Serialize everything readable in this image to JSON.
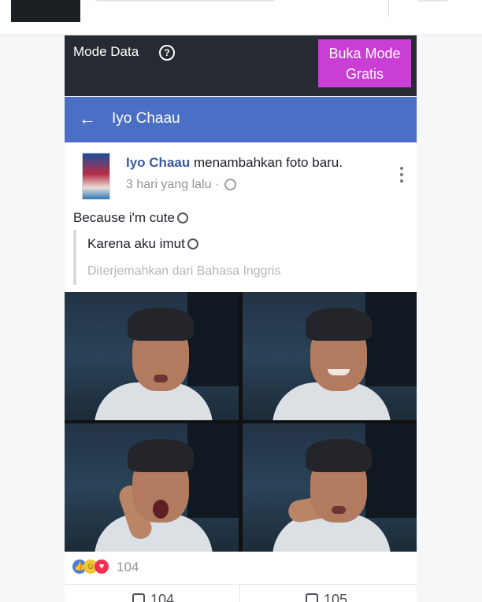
{
  "top": {
    "thumbnail": "dark-thumbnail"
  },
  "databar": {
    "label": "Mode Data",
    "free_mode_button": "Buka Mode\nGratis",
    "help_icon": "question-circle-icon"
  },
  "navbar": {
    "title": "Iyo Chaau",
    "back_icon": "back-arrow-icon"
  },
  "post": {
    "author_name": "Iyo Chaau",
    "action_text": " menambahkan foto baru.",
    "time_ago": "3 hari yang lalu",
    "separator": " ·",
    "privacy_icon": "globe-icon",
    "menu_icon": "vertical-dots-icon",
    "caption": "Because i'm cute",
    "translated_caption": "Karena aku imut",
    "translation_note": "Diterjemahkan dari Bahasa Inggris"
  },
  "photos": [
    {
      "label": "photo-1"
    },
    {
      "label": "photo-2"
    },
    {
      "label": "photo-3"
    },
    {
      "label": "photo-4"
    }
  ],
  "reactions": {
    "count": "104",
    "icons": [
      "like-icon",
      "haha-icon",
      "love-icon"
    ]
  },
  "actions": {
    "like_count": "104",
    "comment_count": "105"
  },
  "colors": {
    "navbar": "#4b6fc5",
    "free_mode": "#c93fd4",
    "dark_bar": "#262b33"
  }
}
